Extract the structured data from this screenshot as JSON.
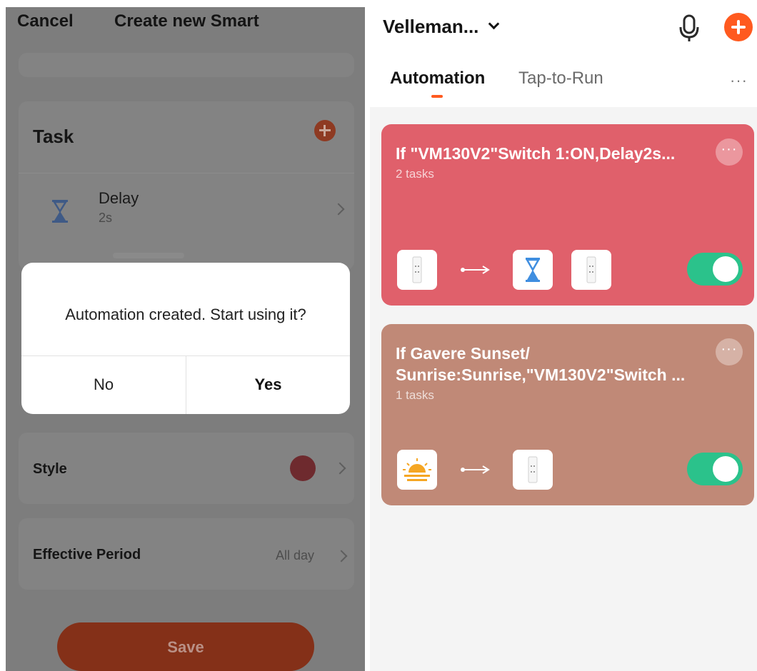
{
  "left": {
    "cancel_label": "Cancel",
    "title": "Create new Smart",
    "task": {
      "title": "Task",
      "delay_label": "Delay",
      "delay_value": "2s"
    },
    "style_label": "Style",
    "style_color": "#6e2a2e",
    "effective_period_label": "Effective Period",
    "effective_period_value": "All day",
    "save_label": "Save",
    "dialog": {
      "message": "Automation created. Start using it?",
      "no_label": "No",
      "yes_label": "Yes"
    }
  },
  "right": {
    "home_name": "Velleman...",
    "tabs": [
      {
        "label": "Automation",
        "active": true
      },
      {
        "label": "Tap-to-Run",
        "active": false
      }
    ],
    "more_label": "···",
    "accent_color": "#ff5a1f",
    "scenes": [
      {
        "title": "If \"VM130V2\"Switch 1:ON,Delay2s...",
        "subtitle": "2 tasks",
        "color": "#e0606b",
        "more_label": "···",
        "enabled": true,
        "icons": [
          "switch-icon",
          "arrow-icon",
          "hourglass-icon",
          "switch-icon"
        ]
      },
      {
        "title": "If Gavere Sunset/ Sunrise:Sunrise,\"VM130V2\"Switch ...",
        "subtitle": "1 tasks",
        "color": "#c08977",
        "more_label": "···",
        "enabled": true,
        "icons": [
          "sunrise-icon",
          "arrow-icon",
          "switch-icon"
        ]
      }
    ],
    "toggle_on_color": "#2bc28b"
  }
}
